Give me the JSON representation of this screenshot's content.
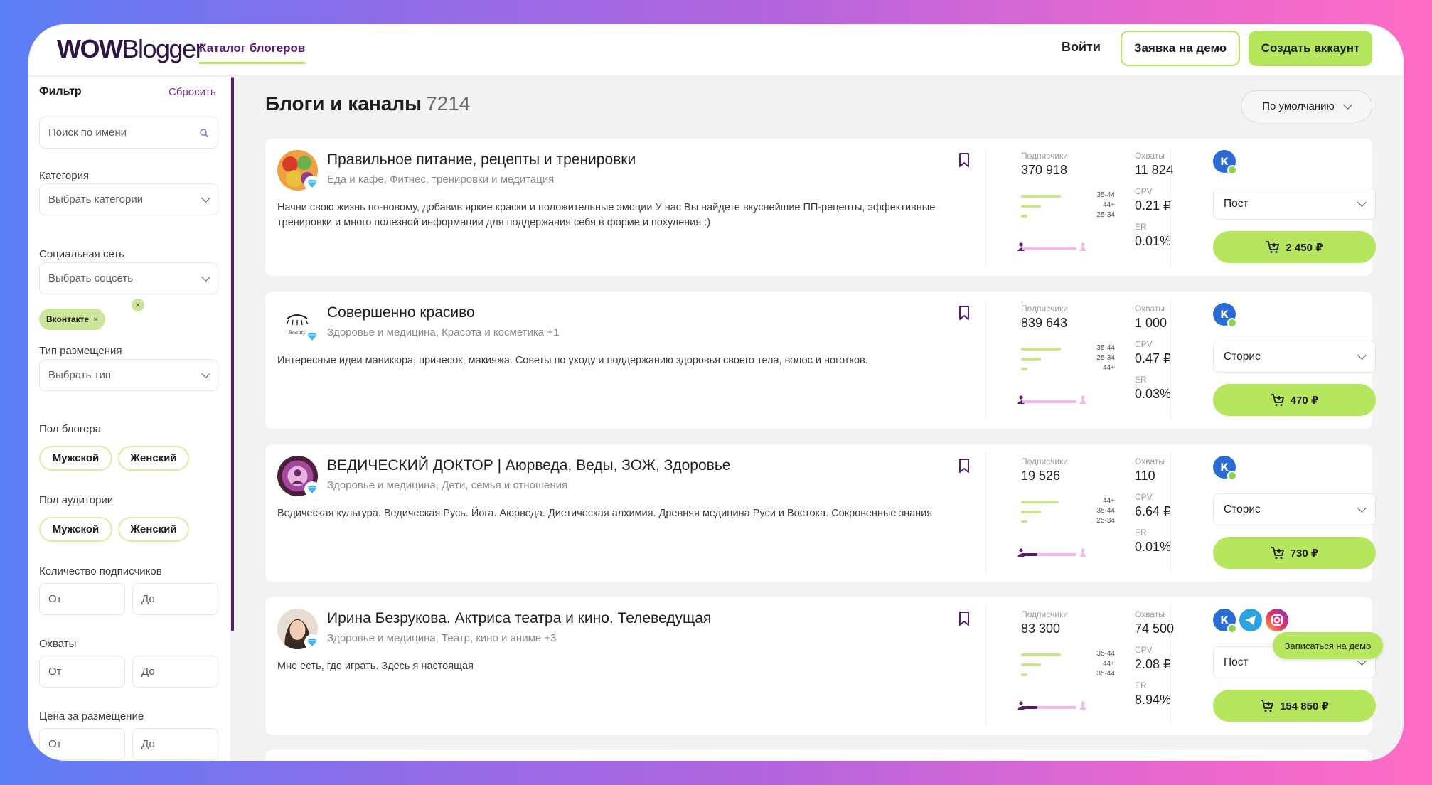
{
  "header": {
    "logo_bold": "WOW",
    "logo_light": "Blogger",
    "nav_catalog": "Каталог блогеров",
    "login": "Войти",
    "demo_button": "Заявка на демо",
    "create_button": "Создать аккаунт"
  },
  "sidebar": {
    "title": "Фильтр",
    "reset": "Сбросить",
    "search_placeholder": "Поиск по имени",
    "category_label": "Категория",
    "category_value": "Выбрать категории",
    "social_label": "Социальная сеть",
    "social_value": "Выбрать соцсеть",
    "social_tag": "Вконтакте",
    "placement_label": "Тип размещения",
    "placement_value": "Выбрать тип",
    "blogger_gender_label": "Пол блогера",
    "audience_gender_label": "Пол аудитории",
    "gender_male": "Мужской",
    "gender_female": "Женский",
    "subscribers_label": "Количество подписчиков",
    "reach_label": "Охваты",
    "price_label": "Цена за размещение",
    "from": "От",
    "to": "До"
  },
  "main": {
    "title": "Блоги и каналы",
    "count": "7214",
    "sort": "По умолчанию"
  },
  "metric_labels": {
    "subscribers": "Подписчики",
    "reach": "Охваты",
    "cpv": "CPV",
    "er": "ER"
  },
  "cards": [
    {
      "title": "Правильное питание, рецепты и тренировки",
      "categories": "Еда и кафе,  Фитнес, тренировки и медитация",
      "description": "Начни свою жизнь по-новому, добавив яркие краски и положительные эмоции У нас Вы найдете вкуснейшие ПП-рецепты, эффективные тренировки и много полезной информации для поддержания себя в форме и похудения :)",
      "subscribers": "370 918",
      "reach": "11 824",
      "cpv": "0.21 ₽",
      "er": "0.01%",
      "ages": [
        "35-44",
        "44+",
        "25-34"
      ],
      "age_shares": [
        0.9,
        0.45,
        0.15
      ],
      "male_share": 0.03,
      "placement": "Пост",
      "price": "2 450 ₽",
      "socials": [
        "vk-icon"
      ]
    },
    {
      "title": "Совершенно красиво",
      "categories": "Здоровье и медицина,  Красота и косметика  +1",
      "description": "Интересные идеи маникюра, причесок, макияжа. Советы по уходу и поддержанию здоровья своего тела, волос и ноготков.",
      "subscribers": "839 643",
      "reach": "1 000",
      "cpv": "0.47 ₽",
      "er": "0.03%",
      "ages": [
        "35-44",
        "25-34",
        "44+"
      ],
      "age_shares": [
        0.9,
        0.45,
        0.15
      ],
      "male_share": 0.03,
      "placement": "Сторис",
      "price": "470 ₽",
      "socials": [
        "vk-icon"
      ]
    },
    {
      "title": "ВЕДИЧЕСКИЙ ДОКТОР | Аюрведа, Веды, ЗОЖ, Здоровье",
      "categories": "Здоровье и медицина,  Дети, семья и отношения",
      "description": "Ведическая культура. Ведическая Русь. Йога. Аюрведа. Диетическая алхимия. Древняя медицина Руси и Востока. Сокровенные знания",
      "subscribers": "19 526",
      "reach": "110",
      "cpv": "6.64 ₽",
      "er": "0.01%",
      "ages": [
        "44+",
        "35-44",
        "25-34"
      ],
      "age_shares": [
        0.85,
        0.45,
        0.15
      ],
      "male_share": 0.3,
      "placement": "Сторис",
      "price": "730 ₽",
      "socials": [
        "vk-icon"
      ]
    },
    {
      "title": "Ирина Безрукова. Актриса театра и кино. Телеведущая",
      "categories": "Здоровье и медицина,  Театр, кино и аниме  +3",
      "description": "Мне есть, где играть. Здесь я настоящая",
      "subscribers": "83 300",
      "reach": "74 500",
      "cpv": "2.08 ₽",
      "er": "8.94%",
      "ages": [
        "35-44",
        "44+",
        "35-44"
      ],
      "age_shares": [
        0.9,
        0.45,
        0.15
      ],
      "male_share": 0.3,
      "placement": "Пост",
      "price": "154 850 ₽",
      "socials": [
        "vk-icon",
        "telegram-icon",
        "instagram-icon"
      ]
    }
  ],
  "demo_popup": "Записаться на демо",
  "colors": {
    "accent_green": "#b5e65e",
    "brand_purple": "#5a1a74",
    "vk_blue": "#2b6bd6",
    "gender_pink": "#f7b6ec"
  }
}
